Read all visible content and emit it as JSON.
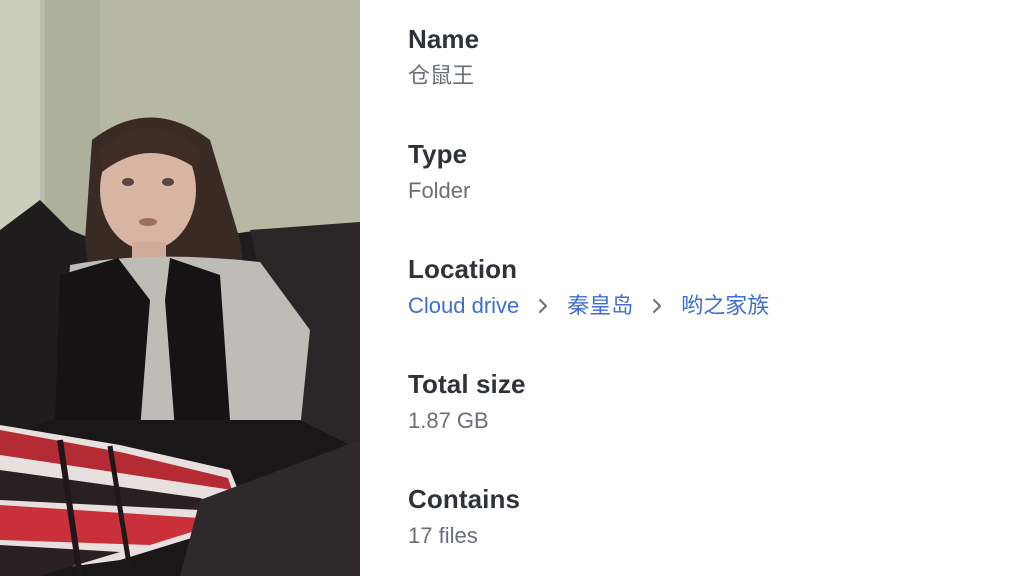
{
  "preview": {
    "kind": "video-thumbnail"
  },
  "details": {
    "name": {
      "label": "Name",
      "value": "仓鼠王"
    },
    "type": {
      "label": "Type",
      "value": "Folder"
    },
    "location": {
      "label": "Location",
      "path": [
        "Cloud drive",
        "秦皇岛",
        "哟之家族"
      ],
      "separator_icon": "chevron-right-icon"
    },
    "total_size": {
      "label": "Total size",
      "value": "1.87 GB"
    },
    "contains": {
      "label": "Contains",
      "value": "17 files"
    }
  },
  "colors": {
    "label": "#2f3338",
    "value": "#6a6f76",
    "link": "#3d6fd0"
  }
}
